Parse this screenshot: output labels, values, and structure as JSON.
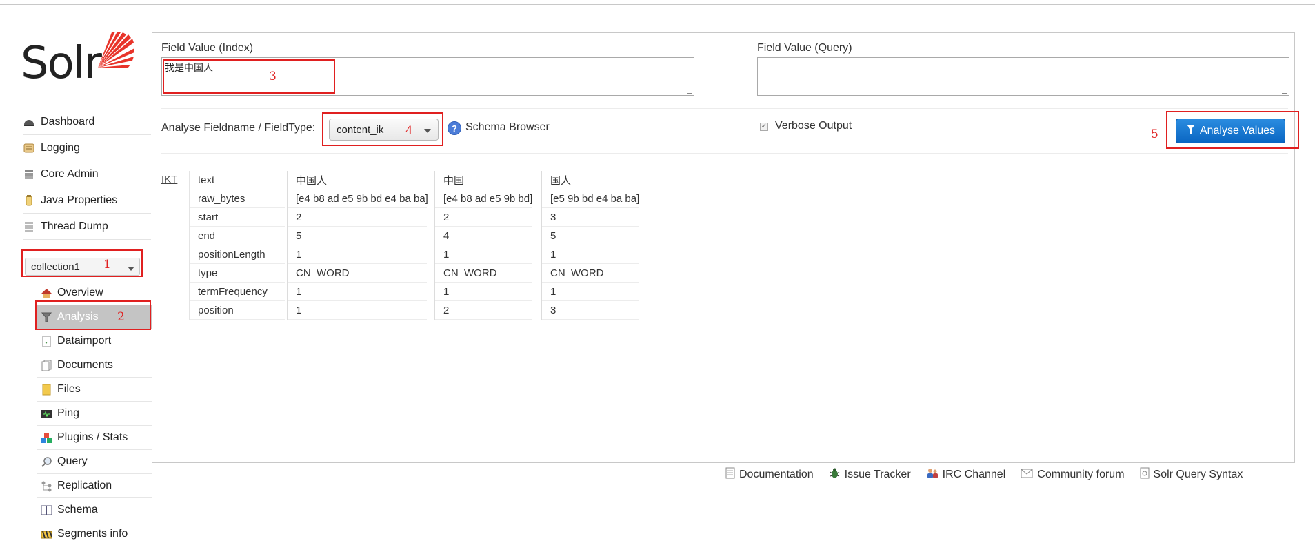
{
  "app": {
    "logo_text": "Solr"
  },
  "sidebar": {
    "items": [
      {
        "label": "Dashboard",
        "icon": "dashboard-icon"
      },
      {
        "label": "Logging",
        "icon": "logging-icon"
      },
      {
        "label": "Core Admin",
        "icon": "core-admin-icon"
      },
      {
        "label": "Java Properties",
        "icon": "java-properties-icon"
      },
      {
        "label": "Thread Dump",
        "icon": "thread-dump-icon"
      }
    ],
    "core_selector": {
      "selected": "collection1"
    },
    "core_items": [
      {
        "label": "Overview",
        "icon": "home-icon"
      },
      {
        "label": "Analysis",
        "icon": "funnel-icon",
        "active": true
      },
      {
        "label": "Dataimport",
        "icon": "dataimport-icon"
      },
      {
        "label": "Documents",
        "icon": "documents-icon"
      },
      {
        "label": "Files",
        "icon": "folder-icon"
      },
      {
        "label": "Ping",
        "icon": "ping-icon"
      },
      {
        "label": "Plugins / Stats",
        "icon": "plugins-icon"
      },
      {
        "label": "Query",
        "icon": "magnifier-icon"
      },
      {
        "label": "Replication",
        "icon": "replication-icon"
      },
      {
        "label": "Schema",
        "icon": "schema-icon"
      },
      {
        "label": "Segments info",
        "icon": "segments-icon"
      }
    ]
  },
  "analysis": {
    "index_label": "Field Value (Index)",
    "index_value": "我是中国人",
    "query_label": "Field Value (Query)",
    "query_value": "",
    "fieldtype_label": "Analyse Fieldname / FieldType:",
    "fieldtype_selected": "content_ik",
    "schema_browser": "Schema Browser",
    "verbose_label": "Verbose Output",
    "verbose_checked": true,
    "analyse_button": "Analyse Values"
  },
  "result": {
    "tokenizer": "IKT",
    "attributes": [
      "text",
      "raw_bytes",
      "start",
      "end",
      "positionLength",
      "type",
      "termFrequency",
      "position"
    ],
    "tokens": [
      [
        "中国人",
        "[e4 b8 ad e5 9b bd e4 ba ba]",
        "2",
        "5",
        "1",
        "CN_WORD",
        "1",
        "1"
      ],
      [
        "中国",
        "[e4 b8 ad e5 9b bd]",
        "2",
        "4",
        "1",
        "CN_WORD",
        "1",
        "2"
      ],
      [
        "国人",
        "[e5 9b bd e4 ba ba]",
        "3",
        "5",
        "1",
        "CN_WORD",
        "1",
        "3"
      ]
    ]
  },
  "annotations": {
    "n1": "1",
    "n2": "2",
    "n3": "3",
    "n4": "4",
    "n5": "5"
  },
  "footer": {
    "links": [
      {
        "label": "Documentation",
        "icon": "document-icon"
      },
      {
        "label": "Issue Tracker",
        "icon": "bug-icon"
      },
      {
        "label": "IRC Channel",
        "icon": "irc-icon"
      },
      {
        "label": "Community forum",
        "icon": "mail-icon"
      },
      {
        "label": "Solr Query Syntax",
        "icon": "syntax-icon"
      }
    ]
  },
  "colors": {
    "accent": "#0a66c2",
    "annotation": "#e02020",
    "logo": "#e8342a"
  }
}
